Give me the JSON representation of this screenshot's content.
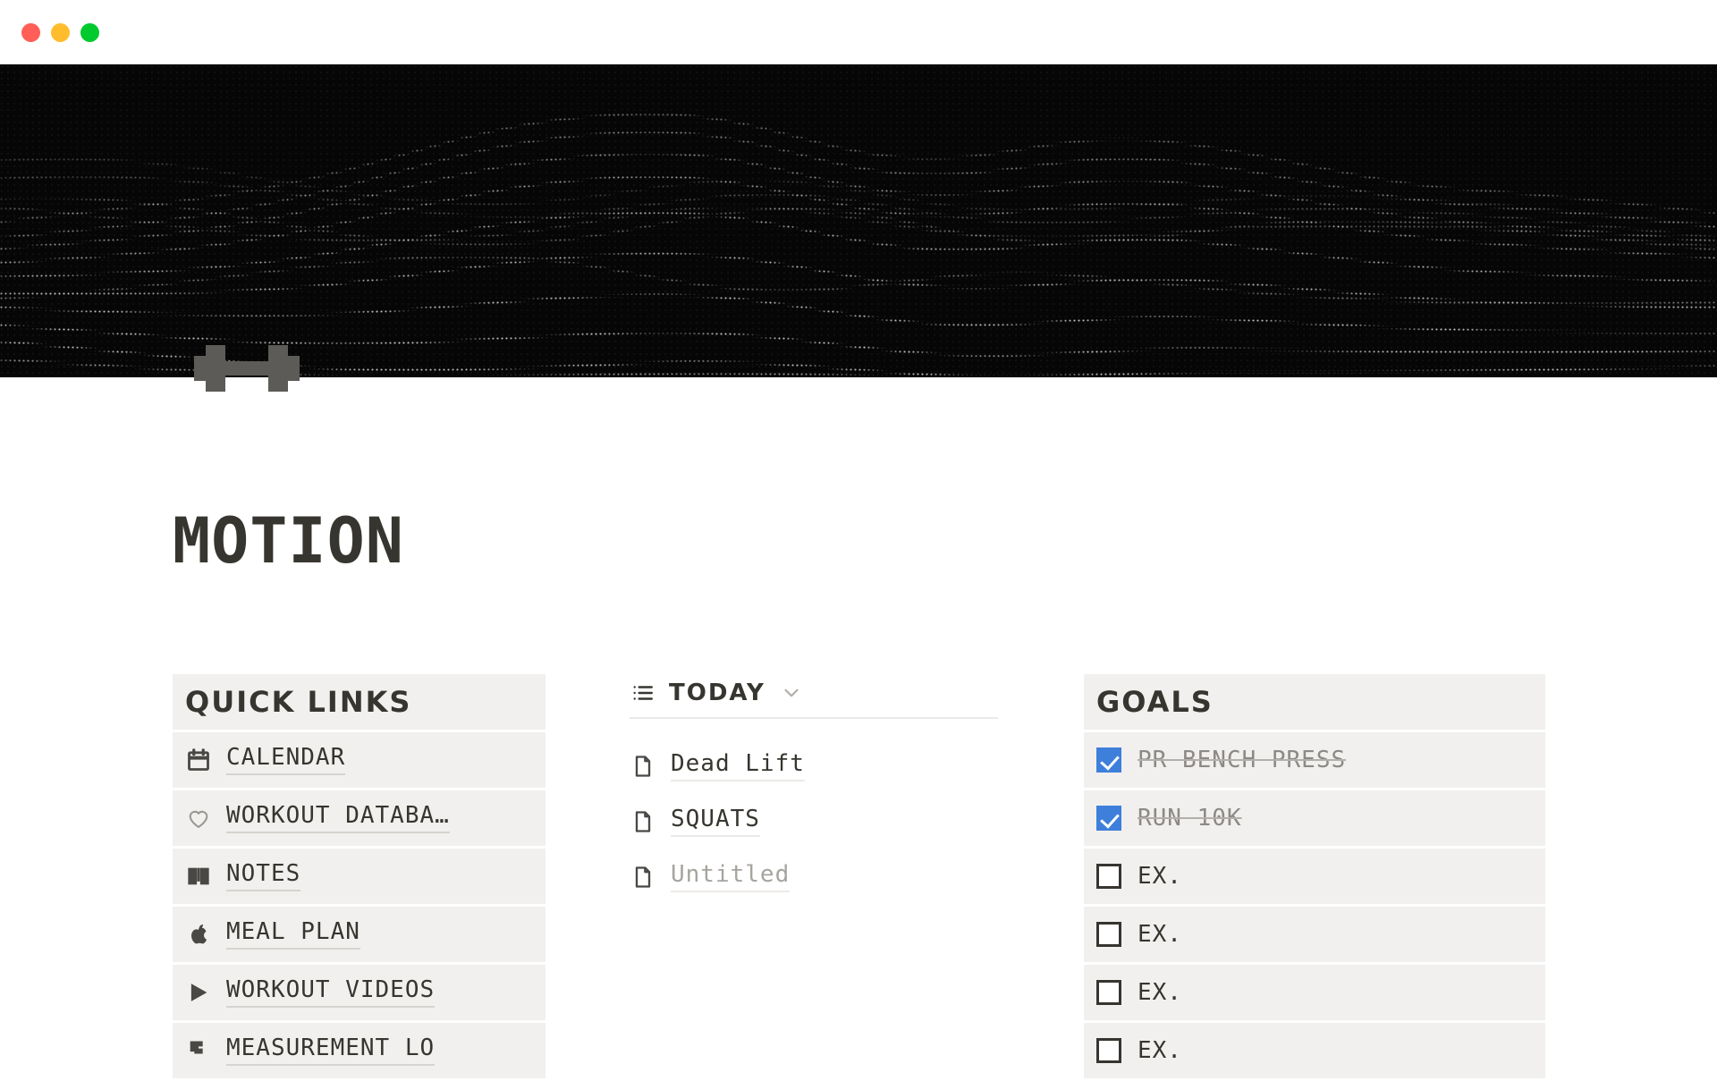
{
  "window": {
    "controls": [
      {
        "name": "close",
        "color": "#ff5f57"
      },
      {
        "name": "minimize",
        "color": "#ffbd2e"
      },
      {
        "name": "maximize",
        "color": "#00ca2e"
      }
    ]
  },
  "cover": {
    "alt": "black topographic wave lines",
    "background": "#060606",
    "line_color": "#d9d9d9"
  },
  "page": {
    "icon": "dumbbell-icon",
    "icon_color": "#5d5b57",
    "title": "MOTION",
    "title_color": "#37352f"
  },
  "quick_links": {
    "heading": "QUICK LINKS",
    "items": [
      {
        "icon": "calendar-icon",
        "label": "CALENDAR"
      },
      {
        "icon": "heart-icon",
        "label": "WORKOUT DATABA…"
      },
      {
        "icon": "book-icon",
        "label": "NOTES"
      },
      {
        "icon": "apple-icon",
        "label": "MEAL PLAN"
      },
      {
        "icon": "play-icon",
        "label": "WORKOUT VIDEOS"
      },
      {
        "icon": "ruler-icon",
        "label": "MEASUREMENT LO"
      }
    ]
  },
  "today": {
    "heading": "TODAY",
    "heading_icon": "list-icon",
    "toggle_icon": "chevron-down-icon",
    "items": [
      {
        "icon": "page-icon",
        "label": "Dead Lift",
        "muted": false
      },
      {
        "icon": "page-icon",
        "label": "SQUATS",
        "muted": false
      },
      {
        "icon": "page-icon",
        "label": "Untitled",
        "muted": true
      }
    ]
  },
  "goals": {
    "heading": "GOALS",
    "accent": "#3e7fdb",
    "items": [
      {
        "label": "PR BENCH PRESS",
        "checked": true
      },
      {
        "label": "RUN 10K",
        "checked": true
      },
      {
        "label": "EX.",
        "checked": false
      },
      {
        "label": "EX.",
        "checked": false
      },
      {
        "label": "EX.",
        "checked": false
      },
      {
        "label": "EX.",
        "checked": false
      }
    ]
  }
}
